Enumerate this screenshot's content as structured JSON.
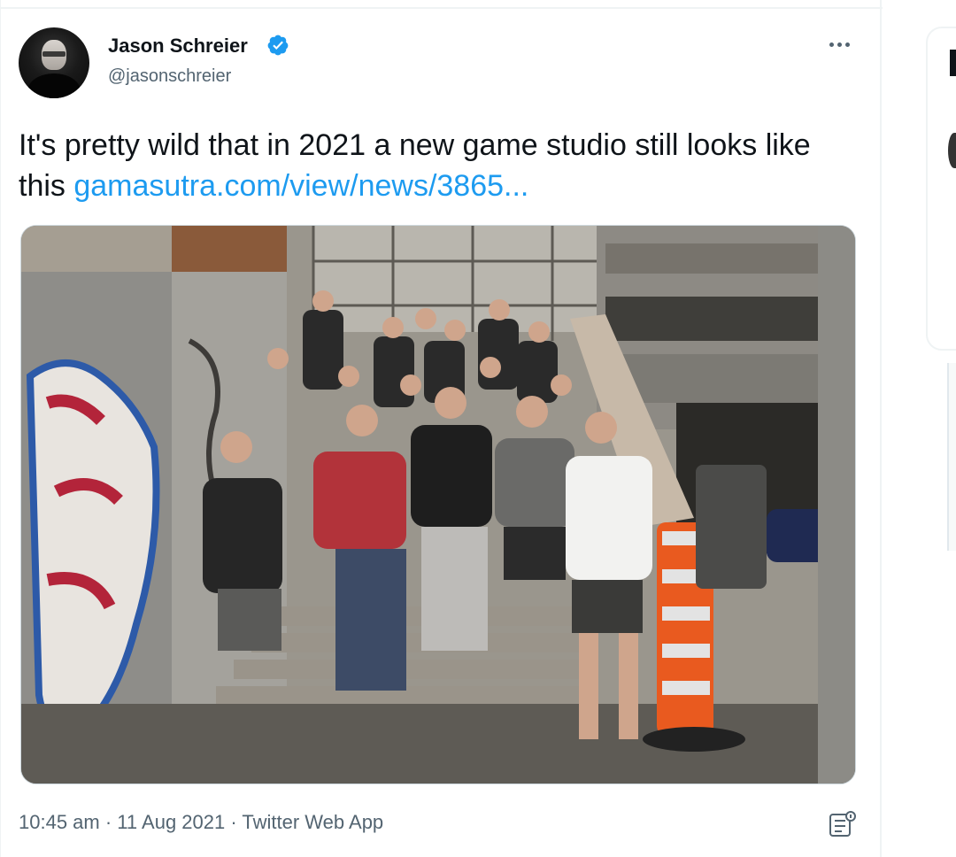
{
  "tweet": {
    "author_name": "Jason Schreier",
    "handle": "@jasonschreier",
    "text": "It's pretty wild that in 2021 a new game studio still looks like this ",
    "link_text": "gamasutra.com/view/news/3865...",
    "time": "10:45 am",
    "separator": " · ",
    "date": "11 Aug 2021",
    "source": "Twitter Web App"
  },
  "icons": {
    "verified": "verified-badge-icon",
    "more": "more-horizontal-icon",
    "analytics": "analytics-icon"
  },
  "colors": {
    "link": "#1d9bf0",
    "text": "#0f1419",
    "muted": "#536471",
    "verified": "#1d9bf0"
  }
}
